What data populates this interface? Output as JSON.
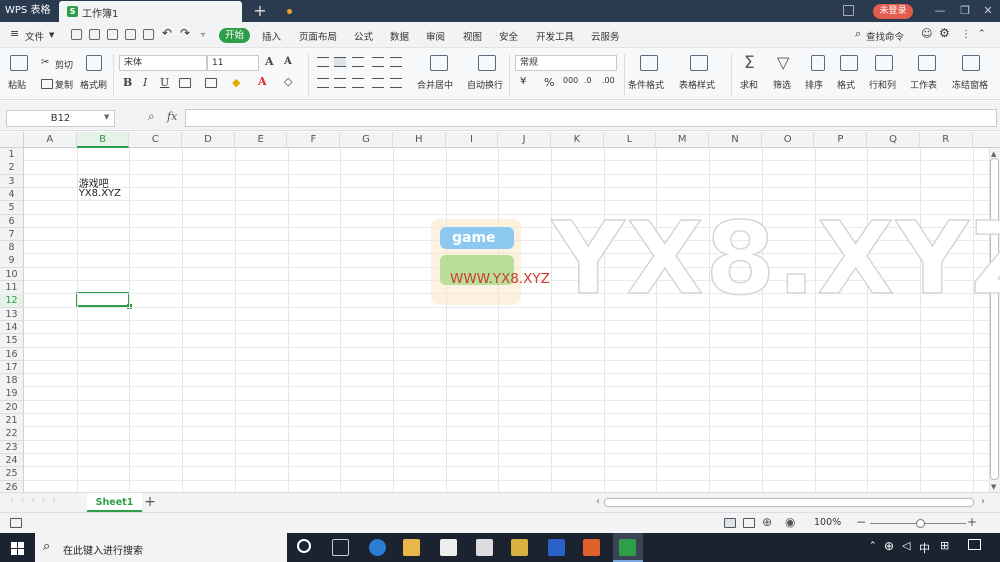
{
  "titlebar": {
    "app_name": "WPS 表格",
    "doc_tab": "工作簿1",
    "new_tab": "+",
    "login_button": "未登录"
  },
  "menu": {
    "file": "文件",
    "items": [
      "开始",
      "插入",
      "页面布局",
      "公式",
      "数据",
      "审阅",
      "视图",
      "安全",
      "开发工具",
      "云服务"
    ],
    "find_command": "查找命令"
  },
  "ribbon": {
    "paste": "粘贴",
    "cut": "剪切",
    "copy": "复制",
    "format_painter": "格式刷",
    "font_name": "宋体",
    "font_size": "11",
    "merge_center": "合并居中",
    "wrap_text": "自动换行",
    "number_format": "常规",
    "conditional_format": "条件格式",
    "table_style": "表格样式",
    "sum": "求和",
    "filter": "筛选",
    "sort": "排序",
    "format": "格式",
    "row_col": "行和列",
    "worksheet": "工作表",
    "freeze": "冻结窗格"
  },
  "formula_bar": {
    "name_box": "B12",
    "fx": "fx",
    "value": ""
  },
  "grid": {
    "columns": [
      "A",
      "B",
      "C",
      "D",
      "E",
      "F",
      "G",
      "H",
      "I",
      "J",
      "K",
      "L",
      "M",
      "N",
      "O",
      "P",
      "Q",
      "R"
    ],
    "rows": [
      "1",
      "2",
      "3",
      "4",
      "5",
      "6",
      "7",
      "8",
      "9",
      "10",
      "11",
      "12",
      "13",
      "14",
      "15",
      "16",
      "17",
      "18",
      "19",
      "20",
      "21",
      "22",
      "23",
      "24",
      "25",
      "26"
    ],
    "selected_cell": "B12",
    "cells": {
      "B3": "游戏吧",
      "B4": "YX8.XYZ"
    }
  },
  "watermark": {
    "logo_text": "game",
    "url": "WWW.YX8.XYZ",
    "big_text": "YX8.XYZ"
  },
  "sheets": {
    "tabs": [
      "Sheet1"
    ],
    "add": "+"
  },
  "statusbar": {
    "zoom": "100%"
  },
  "taskbar": {
    "search_placeholder": "在此键入进行搜索",
    "ime": "中"
  }
}
